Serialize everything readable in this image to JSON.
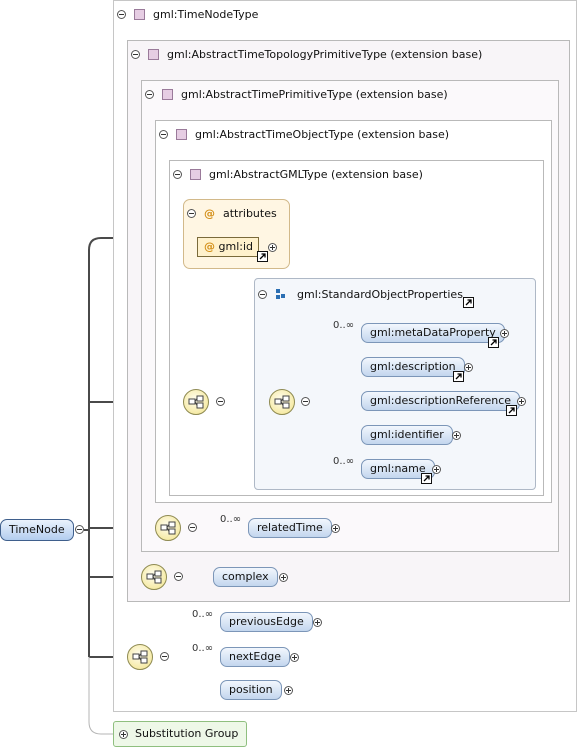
{
  "root": {
    "label": "TimeNode"
  },
  "types": {
    "time_node_type": "gml:TimeNodeType",
    "abstract_topology": "gml:AbstractTimeTopologyPrimitiveType (extension base)",
    "abstract_primitive": "gml:AbstractTimePrimitiveType (extension base)",
    "abstract_object": "gml:AbstractTimeObjectType (extension base)",
    "abstract_gml": "gml:AbstractGMLType (extension base)"
  },
  "attributes": {
    "header": "attributes",
    "at_symbol": "@",
    "items": [
      "gml:id"
    ]
  },
  "group": {
    "title": "gml:StandardObjectProperties",
    "elements": [
      "gml:metaDataProperty",
      "gml:description",
      "gml:descriptionReference",
      "gml:identifier",
      "gml:name"
    ],
    "cardinality_first": "0..∞",
    "cardinality_last": "0..∞"
  },
  "topology": {
    "related_time": "relatedTime",
    "related_cardinality": "0..∞"
  },
  "time_node": {
    "complex": "complex",
    "previous_edge": "previousEdge",
    "previous_cardinality": "0..∞",
    "next_edge": "nextEdge",
    "next_cardinality": "0..∞",
    "position": "position"
  },
  "substitution": {
    "label": "Substitution Group"
  },
  "colors": {
    "element_fill": "#c3d6ee",
    "element_border": "#7c96b8",
    "sequence_fill": "#f6eba8",
    "attribute_fill": "#fff6e3",
    "type_icon": "#e6cde3",
    "substitution_fill": "#eef8e8"
  },
  "icons": {
    "collapse": "minus-circle-icon",
    "expand": "plus-circle-icon",
    "type": "complex-type-icon",
    "reference": "reference-arrow-icon",
    "sequence": "sequence-compositor-icon",
    "group": "group-icon",
    "attribute": "attribute-at-icon"
  }
}
